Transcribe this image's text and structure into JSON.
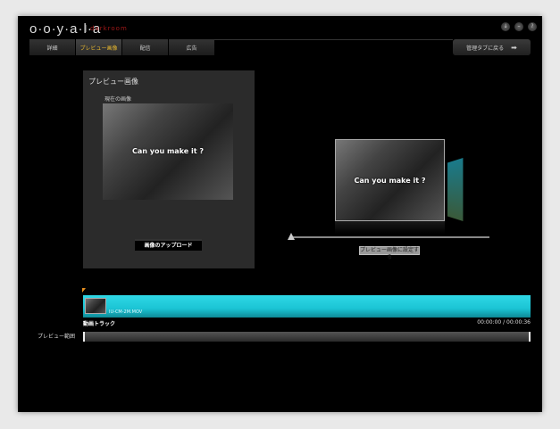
{
  "header": {
    "logo": "o·o·y·a·l·a",
    "logo_sub": "darkroom",
    "window_buttons": [
      "download-icon",
      "minimize-icon",
      "help-icon"
    ]
  },
  "tabs": [
    {
      "label": "詳細"
    },
    {
      "label": "プレビュー画像",
      "active": true
    },
    {
      "label": "配信"
    },
    {
      "label": "広告"
    }
  ],
  "back_button": {
    "label": "管理タブに戻る",
    "icon": "arrow-right-icon"
  },
  "panel": {
    "title": "プレビュー画像",
    "current_label": "現在の画像",
    "image_caption": "Can you make it ?",
    "upload_label": "画像のアップロード"
  },
  "preview": {
    "image_caption": "Can you make it ?",
    "slider_value": 0,
    "set_button": "プレビュー画像に設定する"
  },
  "timeline": {
    "clip_name": "IU-CM-2M.MOV",
    "track_label": "動画トラック",
    "time": "00:00:00 / 00:00:36",
    "range_label": "プレビュー範囲"
  }
}
